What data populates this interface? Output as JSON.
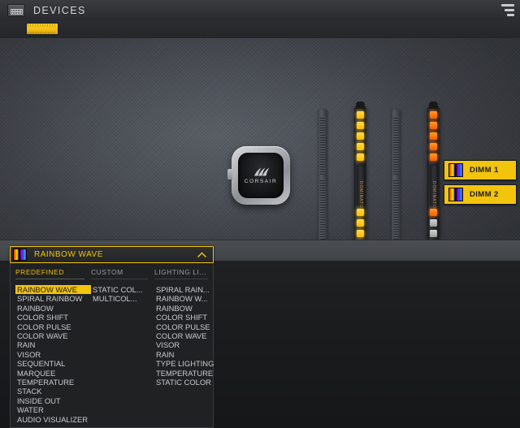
{
  "header": {
    "icon": "dimm-module-icon",
    "title": "DEVICES",
    "menu_icon": "filter-sort-icon"
  },
  "device_strip": {
    "thumb_icon": "memory-module-thumbnail"
  },
  "stage": {
    "cooler": {
      "brand": "CORSAIR",
      "logo_icon": "corsair-sails-icon"
    },
    "modules": [
      {
        "name": "DIMM 1",
        "brand": "DOMINATOR"
      },
      {
        "name": "DIMM 2",
        "brand": "DOMINATOR"
      }
    ],
    "dimm_buttons": [
      {
        "label": "DIMM 1",
        "swatch_icon": "rainbow-gradient-swatch"
      },
      {
        "label": "DIMM 2",
        "swatch_icon": "rainbow-gradient-swatch"
      }
    ]
  },
  "effect_selector": {
    "swatch_icon": "rainbow-gradient-swatch",
    "selected": "RAINBOW WAVE",
    "chevron_icon": "chevron-up-icon",
    "columns": [
      {
        "header": "PREDEFINED",
        "active": true,
        "options": [
          "RAINBOW WAVE",
          "SPIRAL RAINBOW",
          "RAINBOW",
          "COLOR SHIFT",
          "COLOR PULSE",
          "COLOR WAVE",
          "RAIN",
          "VISOR",
          "SEQUENTIAL",
          "MARQUEE",
          "TEMPERATURE",
          "STACK",
          "INSIDE OUT",
          "WATER",
          "AUDIO VISUALIZER"
        ]
      },
      {
        "header": "CUSTOM",
        "active": false,
        "options": [
          "STATIC COL...",
          "MULTICOL..."
        ]
      },
      {
        "header": "LIGHTING LI...",
        "active": false,
        "options": [
          "SPIRAL RAIN...",
          "RAINBOW W...",
          "RAINBOW",
          "COLOR SHIFT",
          "COLOR PULSE",
          "COLOR WAVE",
          "VISOR",
          "RAIN",
          "TYPE LIGHTING",
          "TEMPERATURE",
          "STATIC COLOR"
        ]
      }
    ]
  },
  "colors": {
    "accent": "#f2c40c",
    "led_yellow": "#ffc61a",
    "led_orange": "#ff6a00",
    "led_gray": "#b9bbbe",
    "panel_bg": "#202123",
    "stage_bg": "#4a4e55"
  }
}
